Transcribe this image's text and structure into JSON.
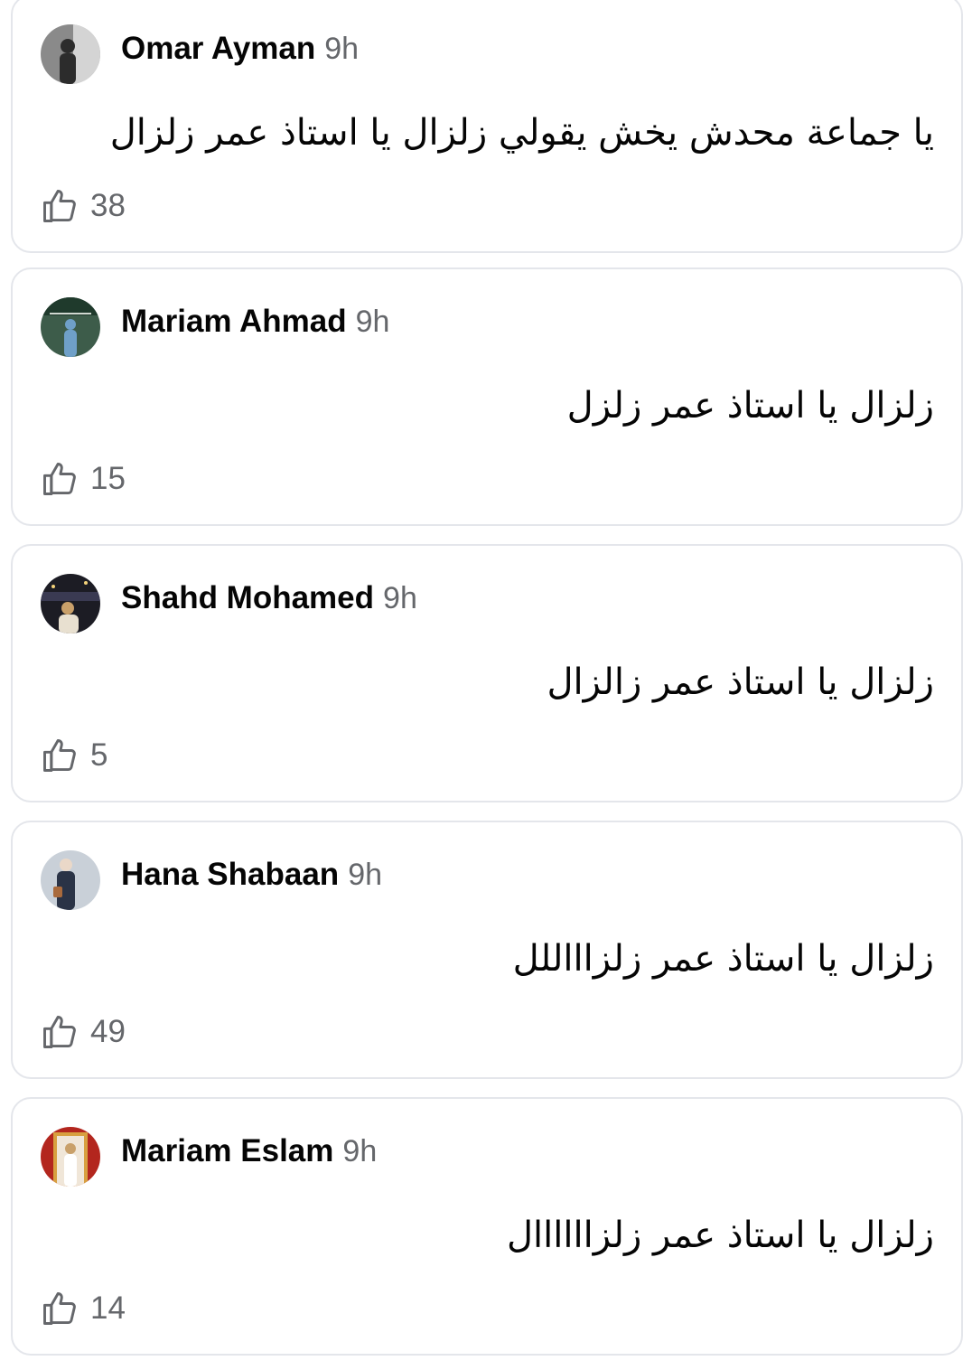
{
  "comments": [
    {
      "name": "Omar Ayman",
      "time": "9h",
      "text": "يا جماعة محدش يخش يقولي زلزال يا استاذ عمر زلزال",
      "likes": "38",
      "avatar_colors": [
        "#8a8a8a",
        "#e6e6e6",
        "#2c2c2c"
      ]
    },
    {
      "name": "Mariam Ahmad",
      "time": "9h",
      "text": "زلزال يا استاذ عمر زلزل",
      "likes": "15",
      "avatar_colors": [
        "#3d5c4a",
        "#6fa0c8",
        "#1f3a2c"
      ]
    },
    {
      "name": "Shahd Mohamed",
      "time": "9h",
      "text": "زلزال يا استاذ عمر زالزال",
      "likes": "5",
      "avatar_colors": [
        "#1c1c24",
        "#c9a06a",
        "#3a3a52"
      ]
    },
    {
      "name": "Hana Shabaan",
      "time": "9h",
      "text": "زلزال يا استاذ عمر زلزاااللل",
      "likes": "49",
      "avatar_colors": [
        "#c9d0d8",
        "#2a3346",
        "#a96a3c"
      ]
    },
    {
      "name": "Mariam Eslam",
      "time": "9h",
      "text": "زلزال يا استاذ عمر زلزاااااال",
      "likes": "14",
      "avatar_colors": [
        "#b3261e",
        "#f0e6d8",
        "#d8a040"
      ]
    }
  ],
  "icons": {
    "like": "thumbs-up-icon"
  },
  "colors": {
    "name": "#050505",
    "meta": "#65676b",
    "border": "#e4e6eb"
  }
}
